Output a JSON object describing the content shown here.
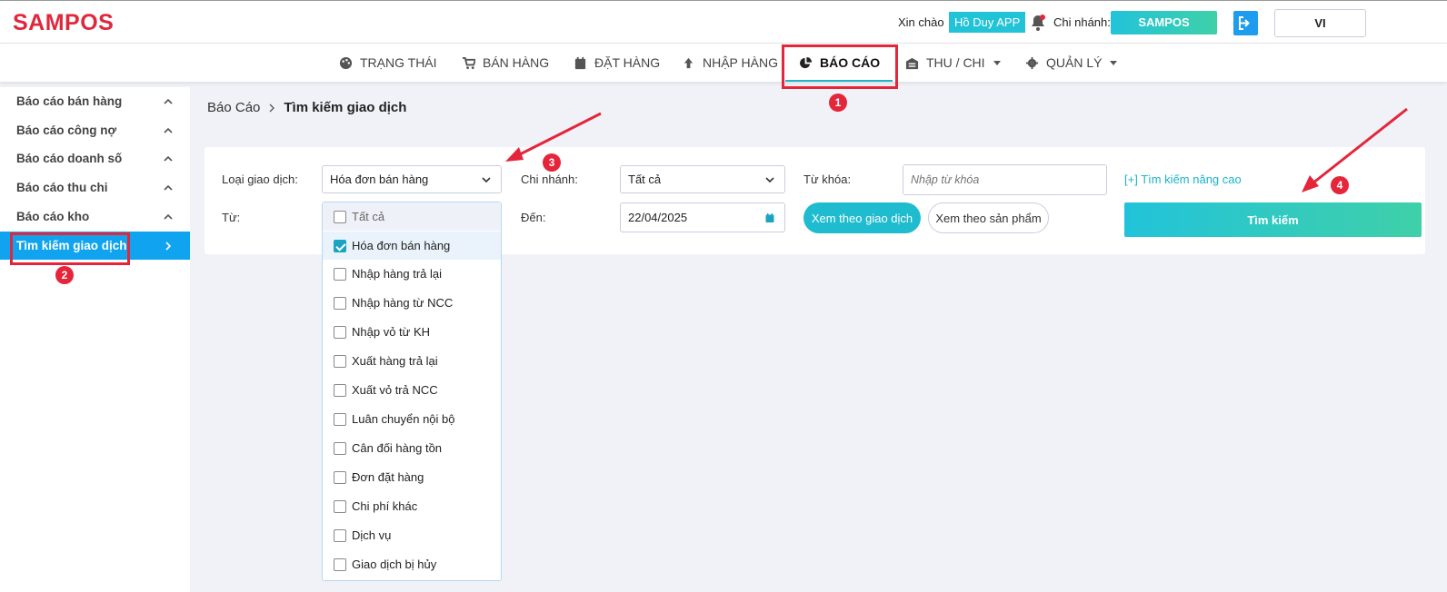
{
  "header": {
    "logo": "SAMPOS",
    "greeting": "Xin chào",
    "user": "Hồ Duy APP",
    "branch_label": "Chi nhánh:",
    "branch": "SAMPOS",
    "language": "VI"
  },
  "nav": {
    "items": [
      {
        "label": "TRẠNG THÁI",
        "icon": "palette-icon"
      },
      {
        "label": "BÁN HÀNG",
        "icon": "cart-icon"
      },
      {
        "label": "ĐẶT HÀNG",
        "icon": "calendar-icon"
      },
      {
        "label": "NHẬP HÀNG",
        "icon": "arrow-up-icon"
      },
      {
        "label": "BÁO CÁO",
        "icon": "pie-chart-icon"
      },
      {
        "label": "THU / CHI",
        "icon": "warehouse-icon"
      },
      {
        "label": "QUẢN LÝ",
        "icon": "gear-icon"
      }
    ]
  },
  "sidebar": {
    "items": [
      {
        "label": "Báo cáo bán hàng"
      },
      {
        "label": "Báo cáo công nợ"
      },
      {
        "label": "Báo cáo doanh số"
      },
      {
        "label": "Báo cáo thu chi"
      },
      {
        "label": "Báo cáo kho"
      },
      {
        "label": "Tìm kiếm giao dịch"
      }
    ]
  },
  "breadcrumb": {
    "parent": "Báo Cáo",
    "current": "Tìm kiếm giao dịch"
  },
  "form": {
    "type_label": "Loại giao dịch:",
    "type_value": "Hóa đơn bán hàng",
    "from_label": "Từ:",
    "branch_label": "Chi nhánh:",
    "branch_value": "Tất cả",
    "to_label": "Đến:",
    "to_value": "22/04/2025",
    "keyword_label": "Từ khóa:",
    "keyword_placeholder": "Nhập từ khóa",
    "advanced_link": "[+] Tìm kiếm nâng cao",
    "view_by_transaction": "Xem theo giao dịch",
    "view_by_product": "Xem theo sản phẩm",
    "search_button": "Tìm kiếm"
  },
  "dropdown": {
    "options": [
      {
        "label": "Tất cả",
        "checked": false
      },
      {
        "label": "Hóa đơn bán hàng",
        "checked": true
      },
      {
        "label": "Nhập hàng trả lại",
        "checked": false
      },
      {
        "label": "Nhập hàng từ NCC",
        "checked": false
      },
      {
        "label": "Nhập vỏ từ KH",
        "checked": false
      },
      {
        "label": "Xuất hàng trả lại",
        "checked": false
      },
      {
        "label": "Xuất vỏ trả NCC",
        "checked": false
      },
      {
        "label": "Luân chuyển nội bộ",
        "checked": false
      },
      {
        "label": "Cân đối hàng tồn",
        "checked": false
      },
      {
        "label": "Đơn đặt hàng",
        "checked": false
      },
      {
        "label": "Chi phí khác",
        "checked": false
      },
      {
        "label": "Dịch vụ",
        "checked": false
      },
      {
        "label": "Giao dịch bị hủy",
        "checked": false
      }
    ]
  },
  "annotations": {
    "badges": [
      "1",
      "2",
      "3",
      "4"
    ]
  },
  "colors": {
    "accent": "#22c3d6",
    "annotation": "#e5253a",
    "sidebar_active": "#10a4f0",
    "logo": "#e0283c"
  }
}
